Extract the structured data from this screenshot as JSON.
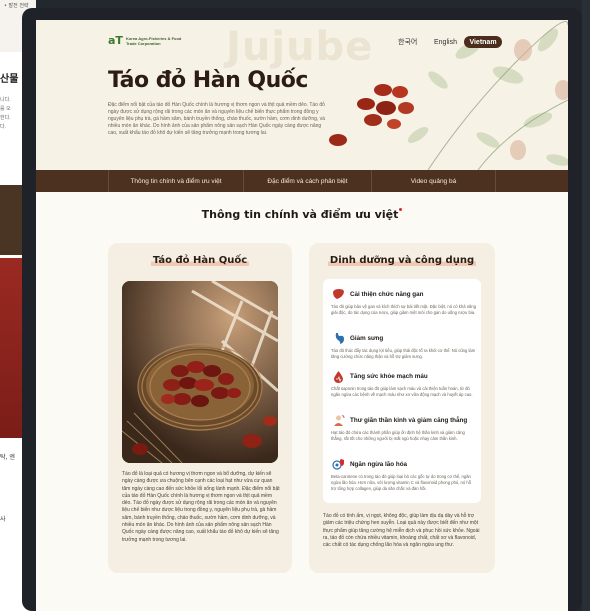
{
  "background": {
    "bullet_text": "• 발전 전략",
    "fragment_title": "산물",
    "fragment_lines": [
      "니다.",
      "를 오",
      "한다.",
      "다."
    ],
    "fragment_bottom": "탁, 엔",
    "fragment_bottom2": "사"
  },
  "header": {
    "ghost_text": "Jujube",
    "logo_mark": "aT",
    "logo_text": "Korea Agro-Fisheries & Food Trade Corporation",
    "languages": [
      {
        "label": "한국어",
        "active": false
      },
      {
        "label": "English",
        "active": false
      },
      {
        "label": "Vietnam",
        "active": true
      }
    ]
  },
  "hero": {
    "title": "Táo đỏ Hàn Quốc",
    "description": "Đặc điểm nổi bật của táo đỏ Hàn Quốc chính là hương vị thơm ngon và thịt quả mềm dẻo. Táo đỏ ngày được sử dụng rộng rãi trong các món ăn và nguyên liệu chế biến thực phẩm trong đồng y nguyên liệu phụ trà, gà hầm sâm, bánh truyền thống, cháo thuốc, sườn hầm, cơm dinh dưỡng, và nhiều món ăn khác. Do hình ảnh của sản phẩm nông sản sạch Hàn Quốc ngày càng được nâng cao, xuất khẩu táo đỏ khô dự kiến sẽ tăng trưởng mạnh trong tương lai."
  },
  "nav": {
    "items": [
      "Thông tin chính và điểm ưu việt",
      "Đặc điểm và cách phân biệt",
      "Video quảng bá"
    ]
  },
  "section": {
    "title": "Thông tin chính và điểm ưu việt"
  },
  "card_left": {
    "title": "Táo đỏ Hàn Quốc",
    "body": "Táo đỏ là loại quả có hương vị thơm ngon và bổ dưỡng, dự kiến sẽ ngày càng được ưa chuộng bên cạnh các loại hạt như vừa cư quan tâm ngày càng cao đến sức khỏe lối sống lành mạnh. Đặc điểm nổi bật của táo đỏ Hàn Quốc chính là hương vị thơm ngon và thịt quả mềm dẻo. Táo đỏ ngày được sử dụng rộng rãi trong các món ăn và nguyên liệu chế biến như dược liệu trong đồng y, nguyên liệu phụ trà, gà hầm sâm, bánh truyền thống, cháo thuốc, sườn hầm, cơm dinh dưỡng, và nhiều món ăn khác. Do hình ảnh của sản phẩm nông sản sạch Hàn Quốc ngày càng được nâng cao, xuất khẩu táo đỏ khô dự kiến sẽ tăng trưởng mạnh trong tương lai."
  },
  "card_right": {
    "title": "Dinh dưỡng và công dụng",
    "benefits": [
      {
        "icon": "liver-icon",
        "title": "Cải thiện chức năng gan",
        "desc": "Táo đỏ giúp bảo vệ gan và kích thích sự bài tiết mật. Đặc biệt, nó có khả năng giải độc, do tác dụng của rượu, giúp giảm mệt mỏi cho gan do uống rượu bia."
      },
      {
        "icon": "stomach-icon",
        "title": "Giảm sưng",
        "desc": "Táo đỏ thúc đẩy tác dụng lợi tiểu, giúp thải độc tố ra khỏi cơ thể. Nó cũng làm tăng cường chức năng thận và hỗ trợ giảm sưng."
      },
      {
        "icon": "blood-drop-icon",
        "title": "Tăng sức khỏe mạch máu",
        "desc": "Chất saponin trong táo đỏ giúp làm sạch máu và cải thiện tuần hoàn, từ đó ngăn ngừa các bệnh về mạch máu như xơ vữa động mạch và huyết áp cao."
      },
      {
        "icon": "relax-person-icon",
        "title": "Thư giãn thần kinh và giảm căng thẳng",
        "desc": "Hạt táo đỏ chứa các thành phần giúp ổn định hệ thần kinh và giảm căng thẳng, rất tốt cho những người bị mất ngủ hoặc nhạy cảm thần kinh."
      },
      {
        "icon": "shield-virus-icon",
        "title": "Ngăn ngừa lão hóa",
        "desc": "Beta-carotene có trong táo đỏ giúp loại bỏ các gốc tự do trong cơ thể, ngăn ngừa lão hóa. Hơn nữa, với lượng vitamin C và flavonoid phong phú, nó hỗ trợ tổng hợp collagen, giúp da săn chắc và đàn hồi."
      }
    ],
    "body": "Táo đỏ có tính ấm, vị ngọt, không độc, giúp làm dịu dạ dày và hỗ trợ giảm các triệu chứng hen suyễn. Loại quả này được biết đến như một thực phẩm giúp tăng cường hệ miễn dịch và phục hồi sức khỏe. Ngoài ra, táo đỏ còn chứa nhiều vitamin, khoáng chất, chất xơ và flavonoid, các chất có tác dụng chống lão hóa và ngăn ngừa ung thư."
  },
  "colors": {
    "nav_bg": "#4d3120",
    "accent_red": "#d62c2c",
    "card_bg": "#f4efe2",
    "lang_active_bg": "#4a2d1d"
  }
}
